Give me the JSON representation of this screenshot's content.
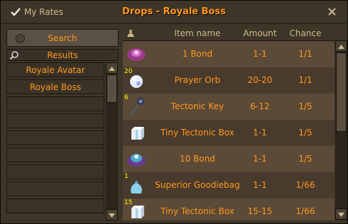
{
  "header": {
    "check_label": "My Rates",
    "title": "Drops - Royale Boss"
  },
  "sidebar": {
    "search_label": "Search",
    "results_label": "Results",
    "items": [
      "Royale Avatar",
      "Royale Boss",
      "",
      "",
      "",
      "",
      "",
      "",
      "",
      ""
    ]
  },
  "table": {
    "columns": [
      "Item name",
      "Amount",
      "Chance"
    ],
    "rows": [
      {
        "icon": "bond-icon",
        "qty": "",
        "name": "1 Bond",
        "amount": "1-1",
        "chance": "1/1"
      },
      {
        "icon": "prayer-orb-icon",
        "qty": "20",
        "name": "Prayer Orb",
        "amount": "20-20",
        "chance": "1/1"
      },
      {
        "icon": "tectonic-key-icon",
        "qty": "6",
        "name": "Tectonic Key",
        "amount": "6-12",
        "chance": "1/5"
      },
      {
        "icon": "tiny-tectonic-box-icon",
        "qty": "",
        "name": "Tiny Tectonic Box",
        "amount": "1-1",
        "chance": "1/5"
      },
      {
        "icon": "bond-icon",
        "qty": "",
        "name": "10 Bond",
        "amount": "1-1",
        "chance": "1/5"
      },
      {
        "icon": "superior-goodiebag-icon",
        "qty": "1",
        "name": "Superior Goodiebag",
        "amount": "1-1",
        "chance": "1/66"
      },
      {
        "icon": "tiny-tectonic-box-icon",
        "qty": "15",
        "name": "Tiny Tectonic Box",
        "amount": "15-15",
        "chance": "1/66"
      }
    ]
  },
  "colors": {
    "text_orange": "#ff981f",
    "header_text": "#cdbb8a",
    "row_light": "#5b4a37",
    "row_dark": "#483a2c",
    "qty_yellow": "#ffff00"
  }
}
